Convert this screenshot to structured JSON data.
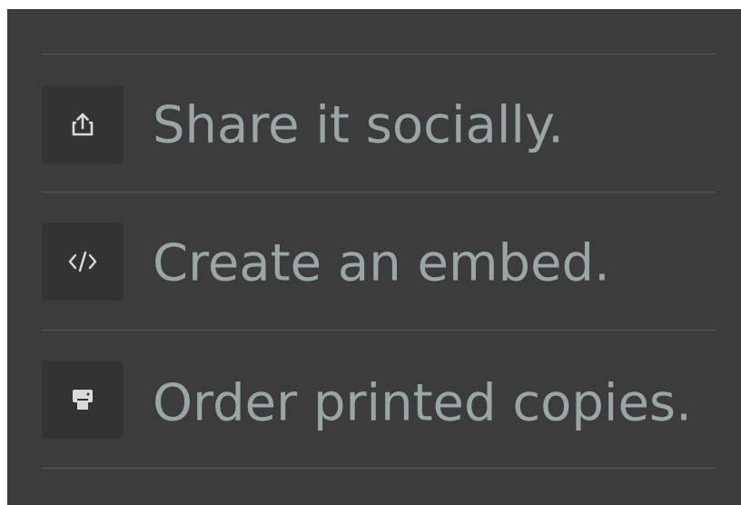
{
  "share_menu": {
    "items": [
      {
        "label": "Share it socially.",
        "icon": "share-icon"
      },
      {
        "label": "Create an embed.",
        "icon": "code-icon"
      },
      {
        "label": "Order printed copies.",
        "icon": "printer-icon"
      }
    ]
  },
  "colors": {
    "background": "#3c3c3c",
    "icon_box": "#333333",
    "text": "#9aa5a5",
    "divider": "#5a5a5a",
    "icon": "#d8dcdc"
  }
}
